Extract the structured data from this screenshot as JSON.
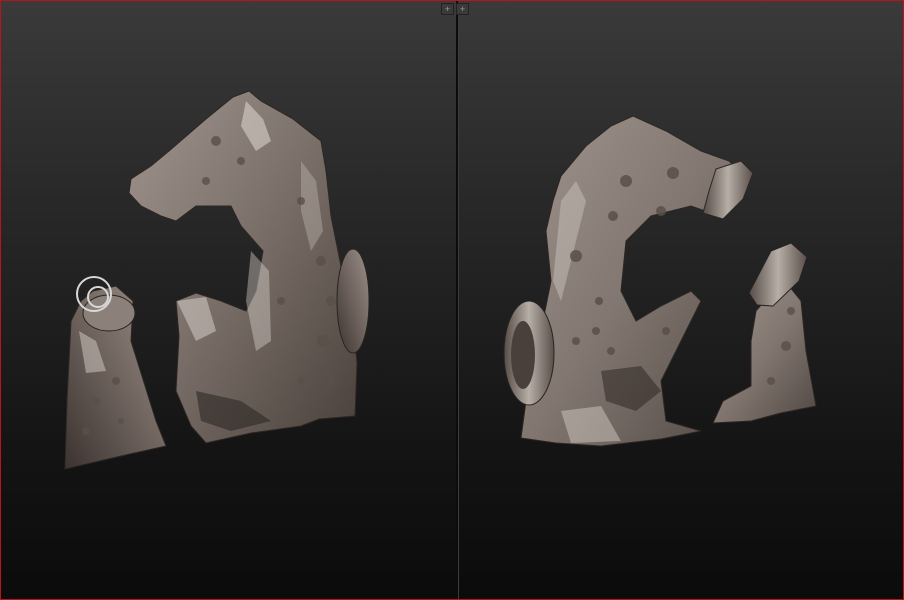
{
  "viewports": [
    {
      "id": "left",
      "model": "horse-sculpt-mesh",
      "view": "front-three-quarter"
    },
    {
      "id": "right",
      "model": "horse-sculpt-mesh",
      "view": "back-three-quarter"
    }
  ],
  "divider": {
    "handles": [
      {
        "icon": "expand-left-icon",
        "glyph": "+"
      },
      {
        "icon": "expand-right-icon",
        "glyph": "+"
      }
    ]
  },
  "colors": {
    "frame_border": "#b3161c",
    "background_top": "#3a3a3a",
    "background_bottom": "#0b0b0b",
    "material_base": "#857a72",
    "material_highlight": "#d9d2cc",
    "material_shadow": "#3b3330"
  }
}
